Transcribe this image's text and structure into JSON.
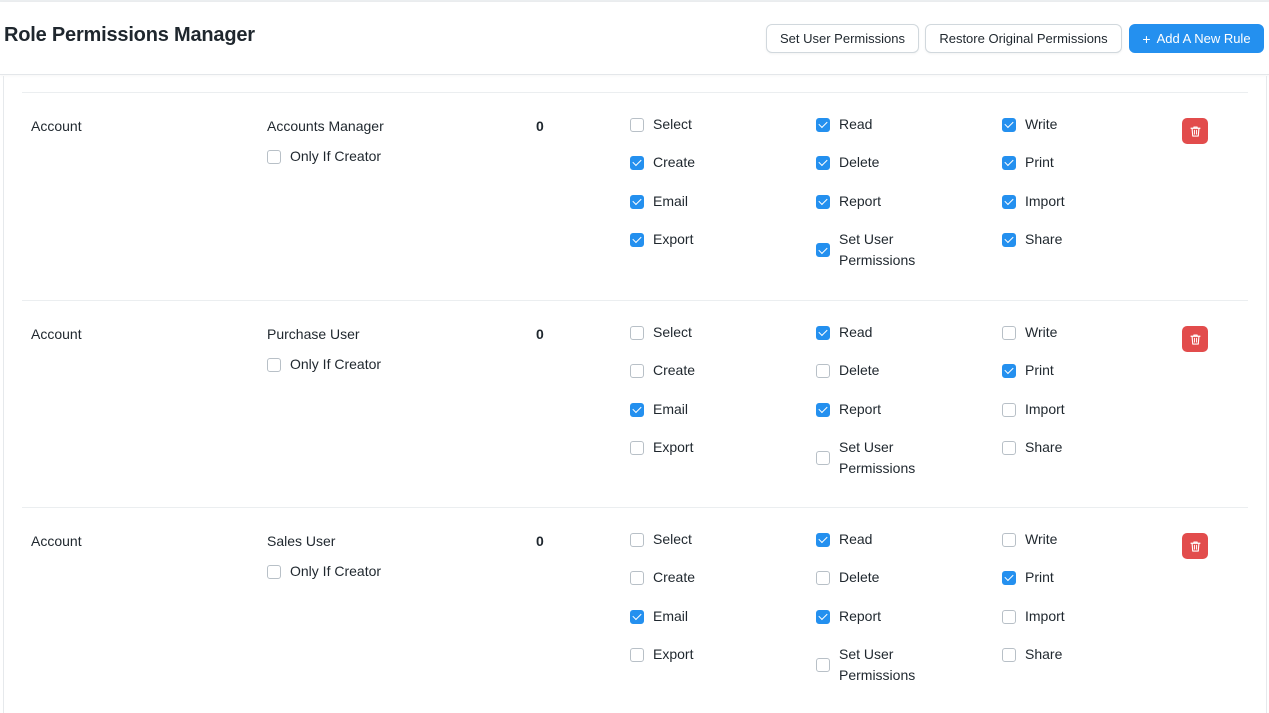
{
  "header": {
    "title": "Role Permissions Manager",
    "set_user_permissions": "Set User Permissions",
    "restore_original_permissions": "Restore Original Permissions",
    "add_new_rule": "Add A New Rule",
    "add_icon": "+"
  },
  "labels": {
    "only_if_creator": "Only If Creator"
  },
  "colors": {
    "primary": "#2490ef",
    "danger": "#e24c4c"
  },
  "rules": [
    {
      "doctype": "Account",
      "role": "Accounts Manager",
      "level": "0",
      "only_if_creator": false,
      "permissions": [
        {
          "label": "Select",
          "checked": false
        },
        {
          "label": "Read",
          "checked": true
        },
        {
          "label": "Write",
          "checked": true
        },
        {
          "label": "Create",
          "checked": true
        },
        {
          "label": "Delete",
          "checked": true
        },
        {
          "label": "Print",
          "checked": true
        },
        {
          "label": "Email",
          "checked": true
        },
        {
          "label": "Report",
          "checked": true
        },
        {
          "label": "Import",
          "checked": true
        },
        {
          "label": "Export",
          "checked": true
        },
        {
          "label": "Set User Permissions",
          "checked": true
        },
        {
          "label": "Share",
          "checked": true
        }
      ]
    },
    {
      "doctype": "Account",
      "role": "Purchase User",
      "level": "0",
      "only_if_creator": false,
      "permissions": [
        {
          "label": "Select",
          "checked": false
        },
        {
          "label": "Read",
          "checked": true
        },
        {
          "label": "Write",
          "checked": false
        },
        {
          "label": "Create",
          "checked": false
        },
        {
          "label": "Delete",
          "checked": false
        },
        {
          "label": "Print",
          "checked": true
        },
        {
          "label": "Email",
          "checked": true
        },
        {
          "label": "Report",
          "checked": true
        },
        {
          "label": "Import",
          "checked": false
        },
        {
          "label": "Export",
          "checked": false
        },
        {
          "label": "Set User Permissions",
          "checked": false
        },
        {
          "label": "Share",
          "checked": false
        }
      ]
    },
    {
      "doctype": "Account",
      "role": "Sales User",
      "level": "0",
      "only_if_creator": false,
      "permissions": [
        {
          "label": "Select",
          "checked": false
        },
        {
          "label": "Read",
          "checked": true
        },
        {
          "label": "Write",
          "checked": false
        },
        {
          "label": "Create",
          "checked": false
        },
        {
          "label": "Delete",
          "checked": false
        },
        {
          "label": "Print",
          "checked": true
        },
        {
          "label": "Email",
          "checked": true
        },
        {
          "label": "Report",
          "checked": true
        },
        {
          "label": "Import",
          "checked": false
        },
        {
          "label": "Export",
          "checked": false
        },
        {
          "label": "Set User Permissions",
          "checked": false
        },
        {
          "label": "Share",
          "checked": false
        }
      ]
    }
  ]
}
